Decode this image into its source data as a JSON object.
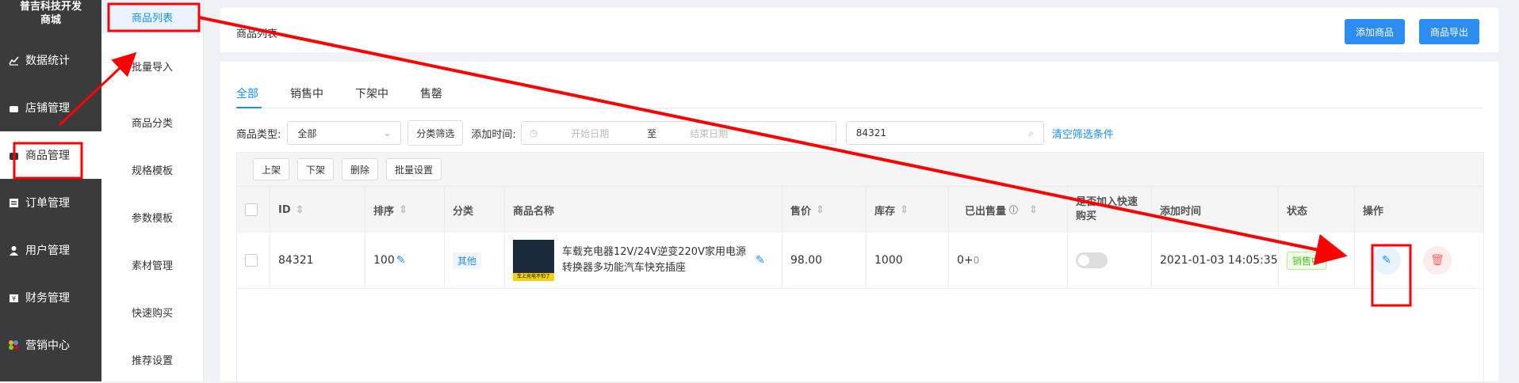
{
  "brand": "普吉科技开发\n商城",
  "left_nav": [
    {
      "label": "数据统计",
      "icon": "chart-icon"
    },
    {
      "label": "店铺管理",
      "icon": "store-icon"
    },
    {
      "label": "商品管理",
      "icon": "bag-icon"
    },
    {
      "label": "订单管理",
      "icon": "order-icon"
    },
    {
      "label": "用户管理",
      "icon": "user-icon"
    },
    {
      "label": "财务管理",
      "icon": "wallet-icon"
    },
    {
      "label": "营销中心",
      "icon": "marketing-icon"
    }
  ],
  "sub_nav": [
    "商品列表",
    "批量导入",
    "商品分类",
    "规格模板",
    "参数模板",
    "素材管理",
    "快速购买",
    "推荐设置"
  ],
  "header": {
    "title": "商品列表",
    "add_label": "添加商品",
    "export_label": "商品导出"
  },
  "tabs": [
    "全部",
    "销售中",
    "下架中",
    "售罄"
  ],
  "filters": {
    "type_label": "商品类型:",
    "type_value": "全部",
    "category_filter": "分类筛选",
    "time_label": "添加时间:",
    "start_placeholder": "开始日期",
    "to": "至",
    "end_placeholder": "结束日期",
    "search_value": "84321",
    "clear": "清空筛选条件"
  },
  "bulk_actions": [
    "上架",
    "下架",
    "删除",
    "批量设置"
  ],
  "columns": {
    "id": "ID",
    "sort": "排序",
    "category": "分类",
    "name": "商品名称",
    "price": "售价",
    "stock": "库存",
    "sold": "已出售量",
    "quick_buy": "是否加入快速购买",
    "created": "添加时间",
    "status": "状态",
    "actions": "操作"
  },
  "row": {
    "id": "84321",
    "sort": "100",
    "category": "其他",
    "name": "车载充电器12V/24V逆变220V家用电源转换器多功能汽车快充插座",
    "thumb_text": "车上充电不怕了",
    "price": "98.00",
    "stock": "1000",
    "sold": "0+",
    "sold_extra": "0",
    "created": "2021-01-03 14:05:35",
    "status": "销售中"
  },
  "colors": {
    "accent": "#1890ff",
    "button": "#2d8cf0",
    "annotation": "#ff0000",
    "sidebar": "#3b3b3b"
  }
}
